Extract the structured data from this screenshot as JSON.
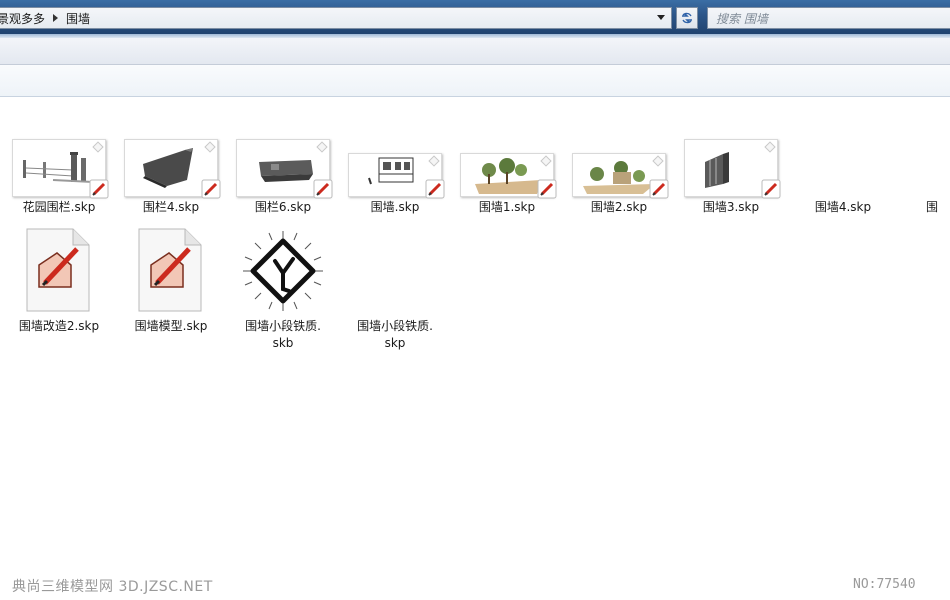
{
  "address_bar": {
    "crumbs": [
      "景观多多",
      "围墙"
    ],
    "search_placeholder": "搜索 围墙"
  },
  "files": [
    {
      "label": "花园围栏.skp",
      "thumb": "fence-render"
    },
    {
      "label": "围栏4.skp",
      "thumb": "fence4-render"
    },
    {
      "label": "围栏6.skp",
      "thumb": "fence6-render"
    },
    {
      "label": "围墙.skp",
      "thumb": "wall-render"
    },
    {
      "label": "围墙1.skp",
      "thumb": "wall1-render"
    },
    {
      "label": "围墙2.skp",
      "thumb": "wall2-render"
    },
    {
      "label": "围墙3.skp",
      "thumb": "wall3-render"
    },
    {
      "label": "围墙4.skp",
      "thumb": ""
    },
    {
      "label": "围",
      "thumb": ""
    },
    {
      "label": "围墙改造2.skp",
      "thumb": "sketchup-doc-icon"
    },
    {
      "label": "围墙模型.skp",
      "thumb": "sketchup-doc-icon"
    },
    {
      "label": "围墙小段铁质.",
      "label2": "skb",
      "thumb": "skb-diamond-icon"
    },
    {
      "label": "围墙小段铁质.",
      "label2": "skp",
      "thumb": ""
    }
  ],
  "watermark": {
    "left": "典尚三维模型网 3D.JZSC.NET",
    "right": "NO:77540"
  }
}
